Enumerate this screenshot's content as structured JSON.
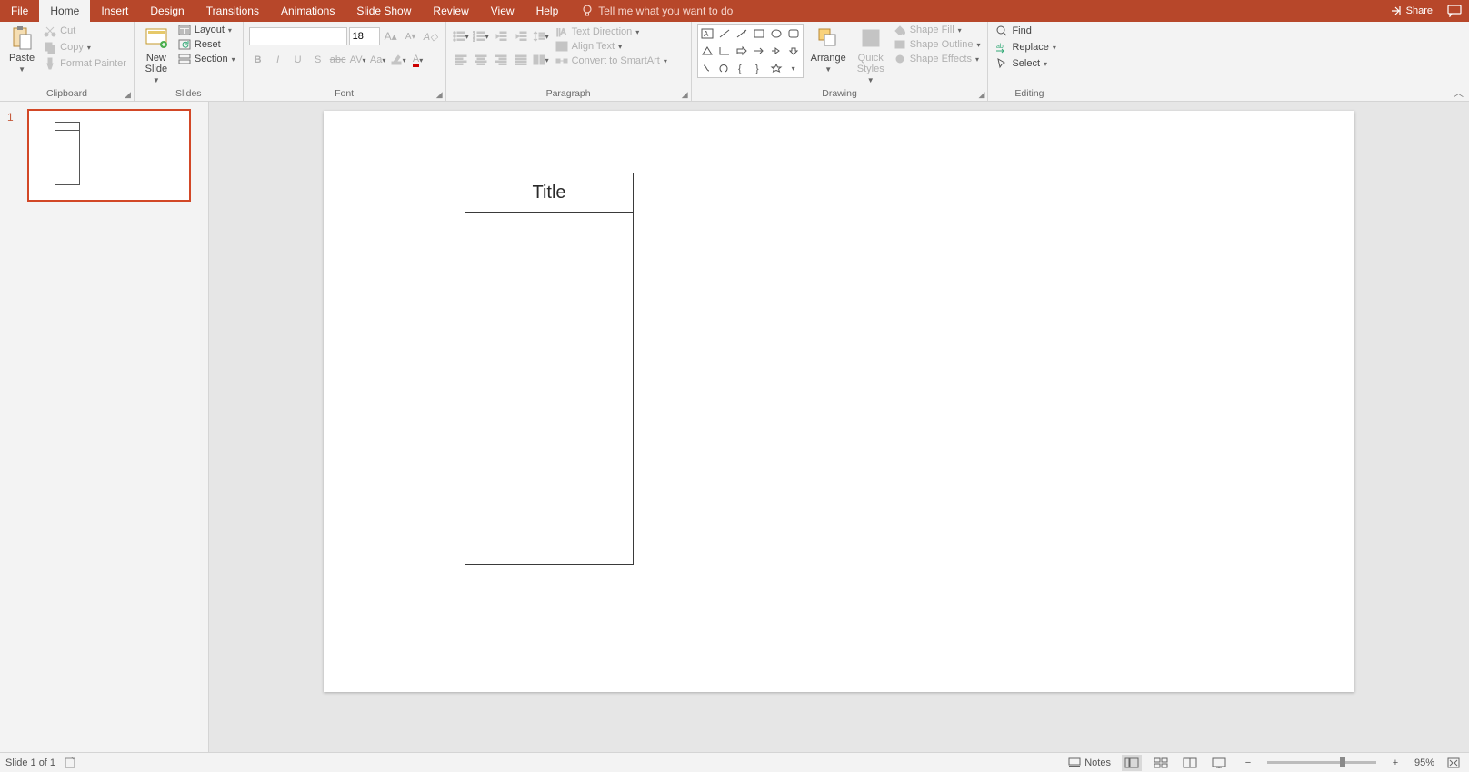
{
  "tabs": {
    "file": "File",
    "home": "Home",
    "insert": "Insert",
    "design": "Design",
    "transitions": "Transitions",
    "animations": "Animations",
    "slideshow": "Slide Show",
    "review": "Review",
    "view": "View",
    "help": "Help",
    "tellme": "Tell me what you want to do",
    "share": "Share"
  },
  "ribbon": {
    "clipboard": {
      "paste": "Paste",
      "cut": "Cut",
      "copy": "Copy",
      "format_painter": "Format Painter",
      "label": "Clipboard"
    },
    "slides": {
      "new_slide": "New\nSlide",
      "layout": "Layout",
      "reset": "Reset",
      "section": "Section",
      "label": "Slides"
    },
    "font": {
      "size": "18",
      "label": "Font"
    },
    "paragraph": {
      "text_direction": "Text Direction",
      "align_text": "Align Text",
      "smartart": "Convert to SmartArt",
      "label": "Paragraph"
    },
    "drawing": {
      "arrange": "Arrange",
      "quick_styles": "Quick\nStyles",
      "shape_fill": "Shape Fill",
      "shape_outline": "Shape Outline",
      "shape_effects": "Shape Effects",
      "label": "Drawing"
    },
    "editing": {
      "find": "Find",
      "replace": "Replace",
      "select": "Select",
      "label": "Editing"
    }
  },
  "panel": {
    "thumb_num": "1"
  },
  "slide": {
    "title_text": "Title"
  },
  "status": {
    "slide_of": "Slide 1 of 1",
    "notes": "Notes",
    "zoom": "95%"
  }
}
